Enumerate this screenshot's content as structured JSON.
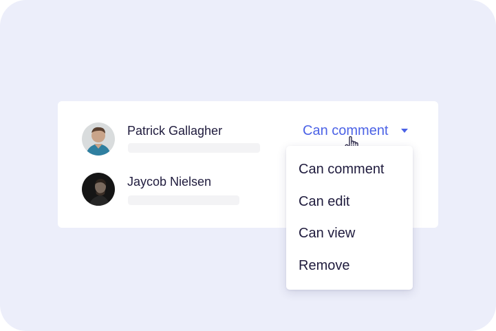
{
  "users": [
    {
      "name": "Patrick Gallagher",
      "avatar": "avatar-photo"
    },
    {
      "name": "Jaycob Nielsen",
      "avatar": "avatar-photo"
    }
  ],
  "permission": {
    "selected": "Can comment",
    "icon": "caret-down-icon"
  },
  "menu": {
    "items": [
      "Can comment",
      "Can edit",
      "Can view",
      "Remove"
    ]
  },
  "colors": {
    "background": "#eceefa",
    "accent": "#4b62e6",
    "text": "#1f1b3d",
    "placeholder_bar": "#f3f3f5"
  },
  "cursor": "hand-pointer-icon"
}
